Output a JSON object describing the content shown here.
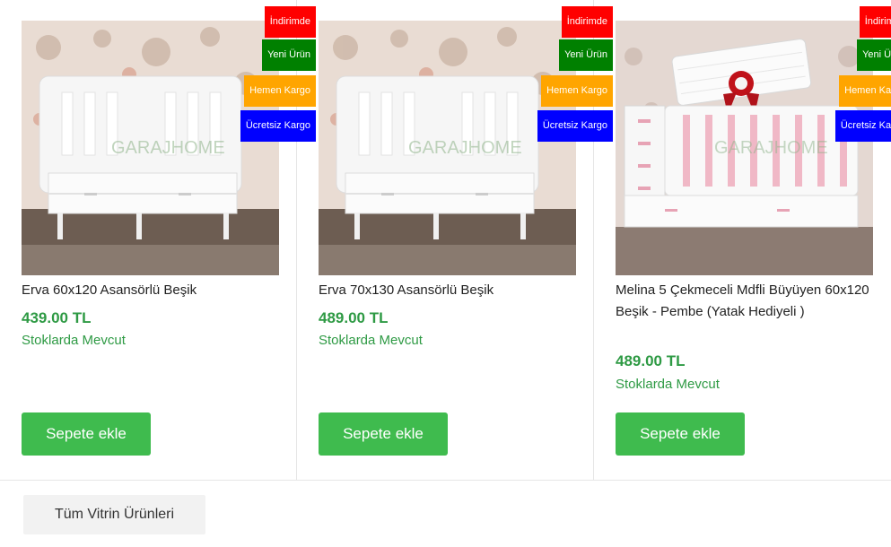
{
  "badges": {
    "discount": "İndirimde",
    "new": "Yeni Ürün",
    "fast": "Hemen Kargo",
    "free": "Ücretsiz Kargo"
  },
  "watermark": "GARAJHOME",
  "products": [
    {
      "title": "Erva 60x120 Asansörlü Beşik",
      "price": "439.00 TL",
      "stock": "Stoklarda Mevcut",
      "button": "Sepete ekle"
    },
    {
      "title": "Erva 70x130 Asansörlü Beşik",
      "price": "489.00 TL",
      "stock": "Stoklarda Mevcut",
      "button": "Sepete ekle"
    },
    {
      "title": "Melina 5 Çekmeceli Mdfli Büyüyen 60x120 Beşik - Pembe (Yatak Hediyeli )",
      "price": "489.00 TL",
      "stock": "Stoklarda Mevcut",
      "button": "Sepete ekle"
    }
  ],
  "footer": {
    "all_products": "Tüm Vitrin Ürünleri"
  },
  "colors": {
    "price_green": "#2e9a44",
    "button_green": "#3fbb4e",
    "badge_red": "#ff0000",
    "badge_green": "#008000",
    "badge_orange": "#ffa500",
    "badge_blue": "#0000ff"
  }
}
